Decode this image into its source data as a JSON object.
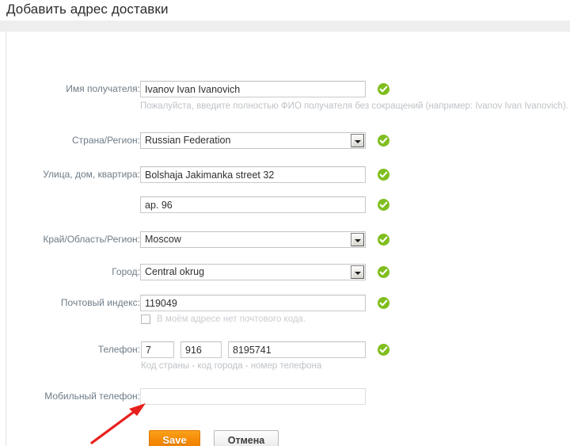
{
  "page": {
    "title": "Добавить адрес доставки"
  },
  "form": {
    "recipient_name": {
      "label": "Имя получателя:",
      "value": "Ivanov Ivan Ivanovich",
      "hint": "Пожалуйста, введите полностью ФИО получателя без сокращений (например: Ivanov Ivan Ivanovich).",
      "valid": true
    },
    "country": {
      "label": "Страна/Регион:",
      "value": "Russian Federation",
      "valid": true
    },
    "street": {
      "label": "Улица, дом, квартира:",
      "value": "Bolshaja Jakimanka street 32",
      "valid": true
    },
    "street2": {
      "label": "",
      "value": "ap. 96",
      "valid": true
    },
    "region": {
      "label": "Край/Область/Регион:",
      "value": "Moscow",
      "valid": true
    },
    "city": {
      "label": "Город:",
      "value": "Central okrug",
      "valid": true
    },
    "postcode": {
      "label": "Почтовый индекс:",
      "value": "119049",
      "valid": true,
      "no_postcode_label": "В моём адресе нет почтового кода.",
      "no_postcode_checked": false
    },
    "phone": {
      "label": "Телефон:",
      "country_code": "7",
      "area_code": "916",
      "number": "8195741",
      "hint": "Код страны - код города - номер телефона",
      "valid": true
    },
    "mobile": {
      "label": "Мобильный телефон:",
      "value": "",
      "placeholder": ""
    }
  },
  "actions": {
    "save_label": "Save",
    "cancel_label": "Отмена"
  },
  "colors": {
    "accent_orange": "#f58b06",
    "valid_green": "#7fbe1e",
    "annotation_red": "#e8201c",
    "label_grey": "#6e7b86",
    "hint_grey": "#bfc3c7"
  }
}
